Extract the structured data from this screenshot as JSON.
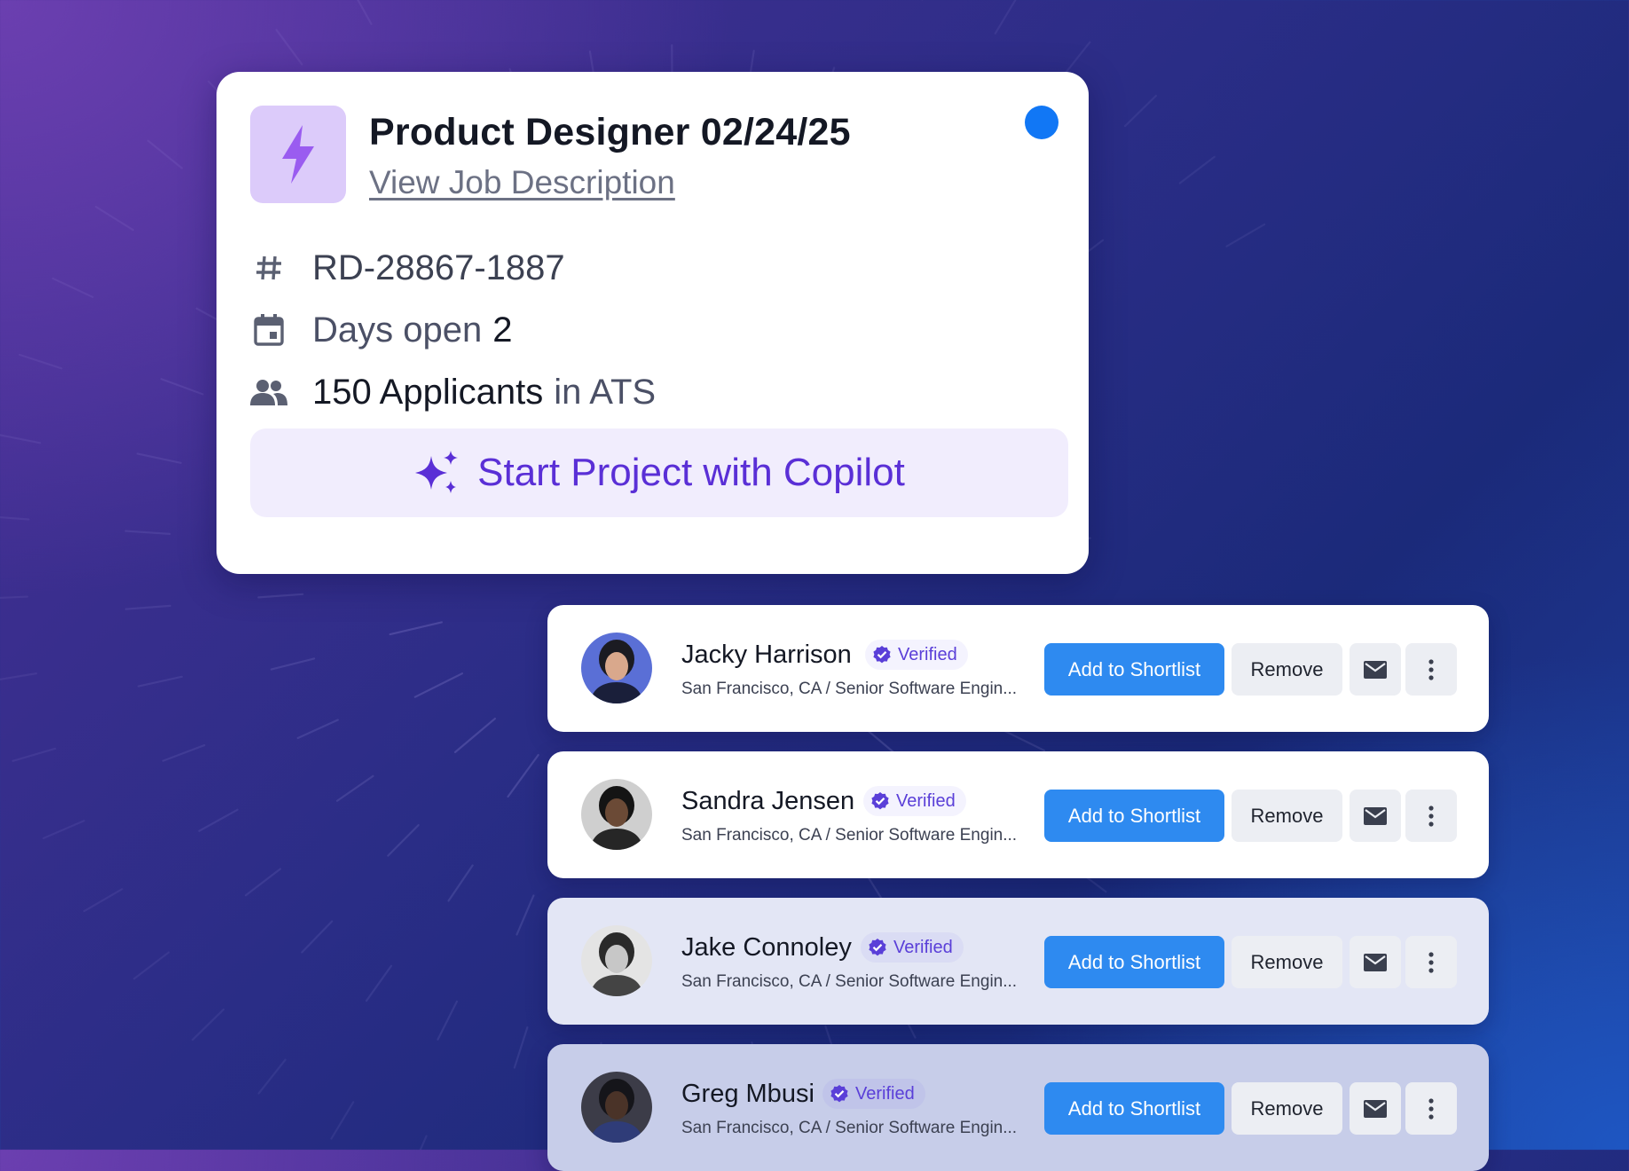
{
  "job": {
    "title": "Product Designer 02/24/25",
    "link": "View Job Description",
    "id": "RD-28867-1887",
    "days_label": "Days open",
    "days_value": "2",
    "applicants_count": "150 Applicants",
    "applicants_suffix": "in ATS",
    "copilot_label": "Start Project with Copilot",
    "icons": [
      "bolt-icon",
      "hash-icon",
      "calendar-icon",
      "people-icon",
      "sparkle-icon"
    ],
    "status_color": "#1177f5"
  },
  "candidates": [
    {
      "name": "Jacky Harrison",
      "verified": "Verified",
      "subtitle": "San Francisco, CA / Senior Software Engin...",
      "shortlist": "Add to Shortlist",
      "remove": "Remove"
    },
    {
      "name": "Sandra Jensen",
      "verified": "Verified",
      "subtitle": "San Francisco, CA / Senior Software Engin...",
      "shortlist": "Add to Shortlist",
      "remove": "Remove"
    },
    {
      "name": "Jake Connoley",
      "verified": "Verified",
      "subtitle": "San Francisco, CA / Senior Software Engin...",
      "shortlist": "Add to Shortlist",
      "remove": "Remove"
    },
    {
      "name": "Greg Mbusi",
      "verified": "Verified",
      "subtitle": "San Francisco, CA / Senior Software Engin...",
      "shortlist": "Add to Shortlist",
      "remove": "Remove"
    }
  ],
  "colors": {
    "accent": "#2e8af0",
    "copilot": "#5a2fd6",
    "verified": "#5a3fd8"
  }
}
